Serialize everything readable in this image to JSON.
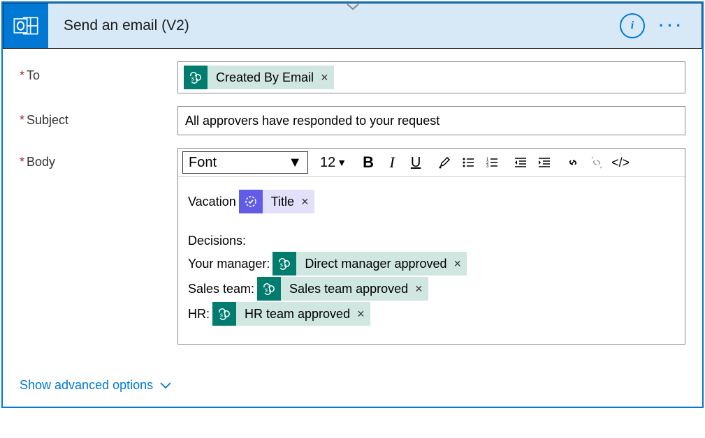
{
  "header": {
    "title": "Send an email (V2)"
  },
  "fields": {
    "to": {
      "label": "To",
      "required": true,
      "tokens": [
        {
          "type": "sp",
          "text": "Created By Email"
        }
      ]
    },
    "subject": {
      "label": "Subject",
      "required": true,
      "value": "All approvers have responded to your request"
    },
    "body": {
      "label": "Body",
      "required": true
    }
  },
  "rte": {
    "font_label": "Font",
    "size_label": "12"
  },
  "body_content": {
    "line1_prefix": "Vacation",
    "title_token": "Title",
    "decisions_label": "Decisions:",
    "manager_label": "Your manager:",
    "manager_token": "Direct manager approved",
    "sales_label": "Sales team:",
    "sales_token": "Sales team approved",
    "hr_label": "HR:",
    "hr_token": "HR team approved"
  },
  "advanced": {
    "label": "Show advanced options"
  }
}
